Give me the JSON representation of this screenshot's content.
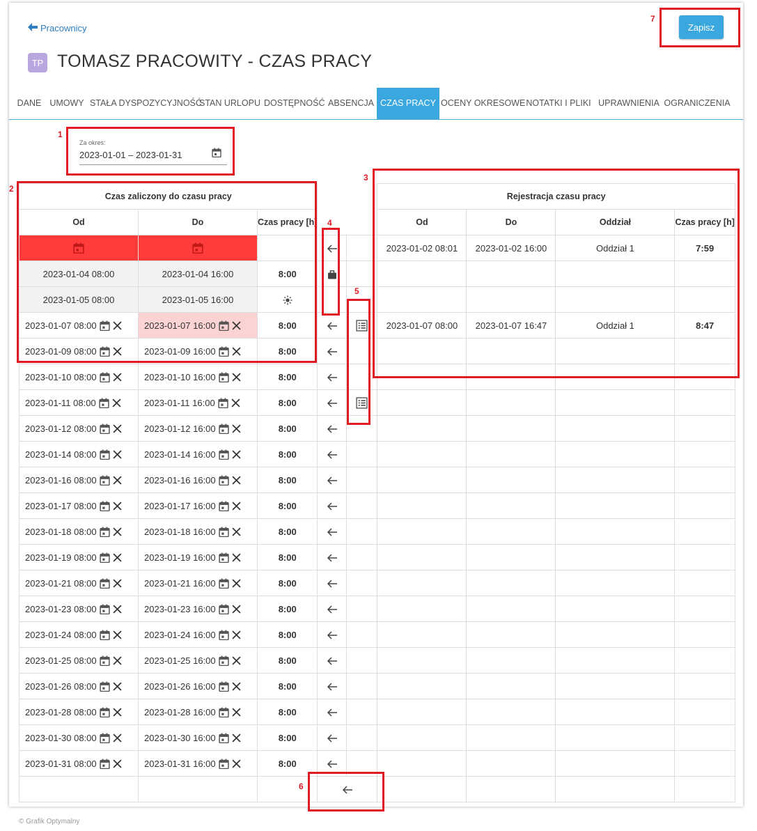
{
  "header": {
    "back_label": "Pracownicy",
    "avatar_initials": "TP",
    "title": "TOMASZ PRACOWITY - CZAS PRACY",
    "save_label": "Zapisz"
  },
  "tabs": [
    "DANE",
    "UMOWY",
    "STAŁA DYSPOZYCYJNOŚĆ",
    "STAN URLOPU",
    "DOSTĘPNOŚĆ",
    "ABSENCJA",
    "CZAS PRACY",
    "OCENY OKRESOWE",
    "NOTATKI I PLIKI",
    "UPRAWNIENIA",
    "OGRANICZENIA"
  ],
  "active_tab": "CZAS PRACY",
  "period": {
    "label": "Za okres:",
    "value": "2023-01-01 – 2023-01-31"
  },
  "left_table": {
    "title": "Czas zaliczony do czasu pracy",
    "columns": [
      "Od",
      "Do",
      "Czas pracy [h]"
    ],
    "readonly_rows": [
      {
        "od": "2023-01-04 08:00",
        "do": "2023-01-04 16:00",
        "czas": "8:00",
        "icon": "briefcase-icon"
      },
      {
        "od": "2023-01-05 08:00",
        "do": "2023-01-05 16:00",
        "czas": "",
        "icon": "sun-icon"
      }
    ],
    "rows": [
      {
        "od": "2023-01-07 08:00",
        "do": "2023-01-07 16:00",
        "czas": "8:00"
      },
      {
        "od": "2023-01-09 08:00",
        "do": "2023-01-09 16:00",
        "czas": "8:00"
      },
      {
        "od": "2023-01-10 08:00",
        "do": "2023-01-10 16:00",
        "czas": "8:00"
      },
      {
        "od": "2023-01-11 08:00",
        "do": "2023-01-11 16:00",
        "czas": "8:00"
      },
      {
        "od": "2023-01-12 08:00",
        "do": "2023-01-12 16:00",
        "czas": "8:00"
      },
      {
        "od": "2023-01-14 08:00",
        "do": "2023-01-14 16:00",
        "czas": "8:00"
      },
      {
        "od": "2023-01-16 08:00",
        "do": "2023-01-16 16:00",
        "czas": "8:00"
      },
      {
        "od": "2023-01-17 08:00",
        "do": "2023-01-17 16:00",
        "czas": "8:00"
      },
      {
        "od": "2023-01-18 08:00",
        "do": "2023-01-18 16:00",
        "czas": "8:00"
      },
      {
        "od": "2023-01-19 08:00",
        "do": "2023-01-19 16:00",
        "czas": "8:00"
      },
      {
        "od": "2023-01-21 08:00",
        "do": "2023-01-21 16:00",
        "czas": "8:00"
      },
      {
        "od": "2023-01-23 08:00",
        "do": "2023-01-23 16:00",
        "czas": "8:00"
      },
      {
        "od": "2023-01-24 08:00",
        "do": "2023-01-24 16:00",
        "czas": "8:00"
      },
      {
        "od": "2023-01-25 08:00",
        "do": "2023-01-25 16:00",
        "czas": "8:00"
      },
      {
        "od": "2023-01-26 08:00",
        "do": "2023-01-26 16:00",
        "czas": "8:00"
      },
      {
        "od": "2023-01-28 08:00",
        "do": "2023-01-28 16:00",
        "czas": "8:00"
      },
      {
        "od": "2023-01-30 08:00",
        "do": "2023-01-30 16:00",
        "czas": "8:00"
      },
      {
        "od": "2023-01-31 08:00",
        "do": "2023-01-31 16:00",
        "czas": "8:00"
      }
    ]
  },
  "right_table": {
    "title": "Rejestracja czasu pracy",
    "columns": [
      "Od",
      "Do",
      "Oddział",
      "Czas pracy [h]"
    ],
    "rows": [
      {
        "od": "2023-01-02 08:01",
        "do": "2023-01-02 16:00",
        "oddzial": "Oddział 1",
        "czas": "7:59"
      },
      {
        "od": "2023-01-07 08:00",
        "do": "2023-01-07 16:47",
        "oddzial": "Oddział 1",
        "czas": "8:47"
      }
    ]
  },
  "markers": [
    "1",
    "2",
    "3",
    "4",
    "5",
    "6",
    "7"
  ],
  "footer": "© Grafik Optymalny",
  "colors": {
    "accent": "#3aa8de",
    "missing_date": "#ff3b3b",
    "conflict": "#fbd3d3",
    "marker": "#e01b24"
  }
}
